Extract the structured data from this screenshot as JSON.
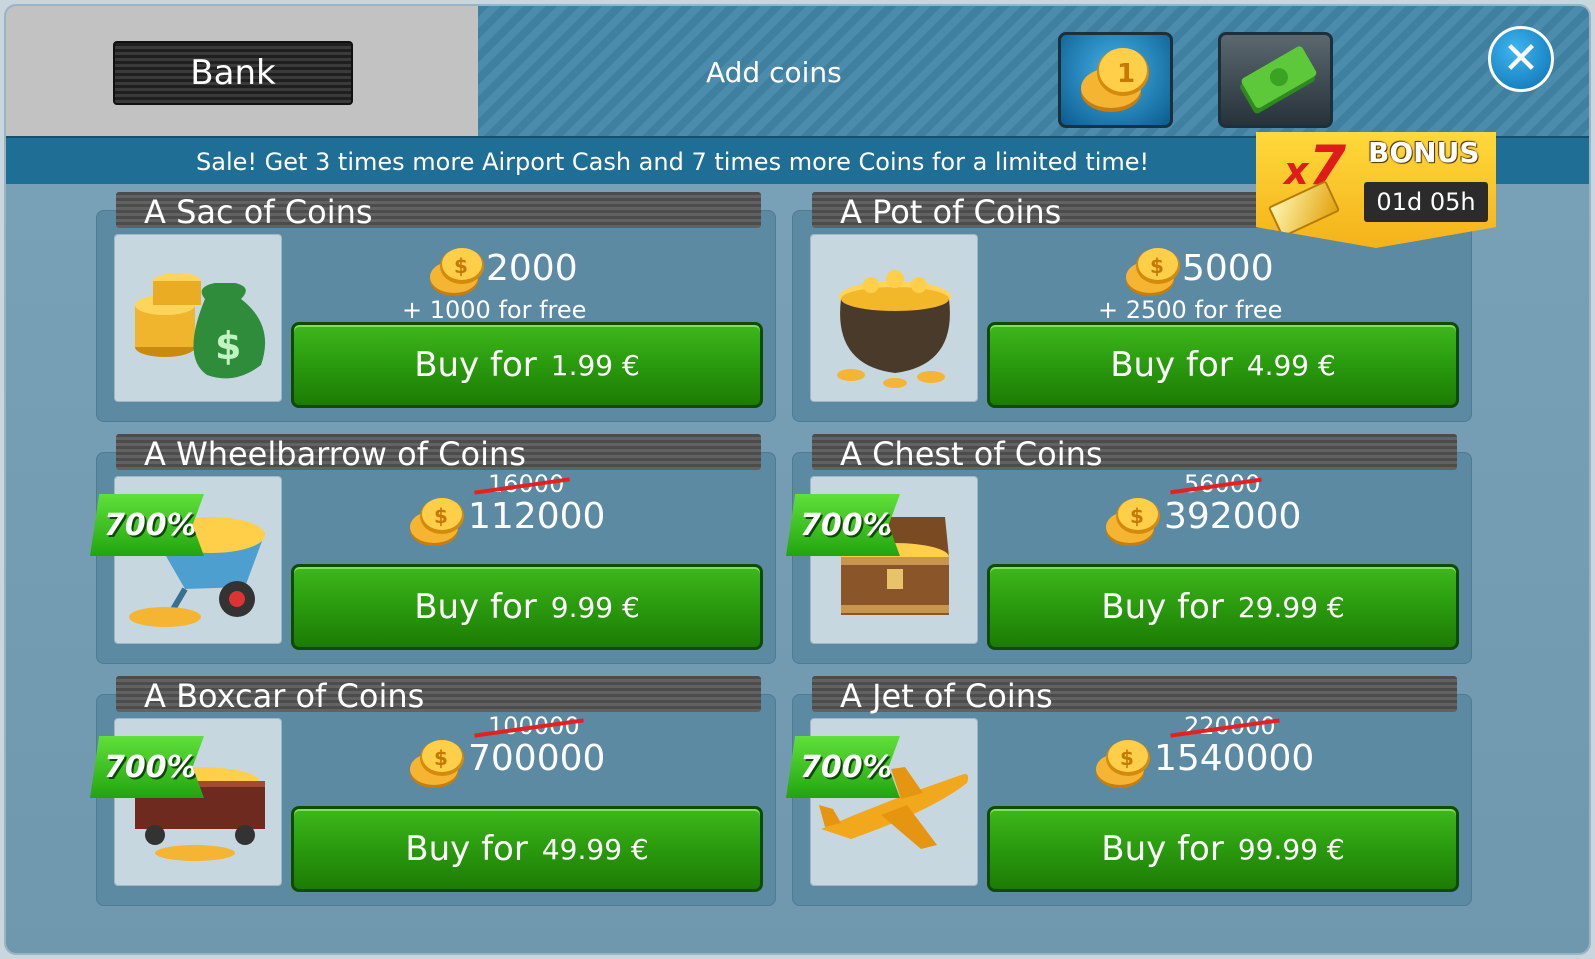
{
  "header": {
    "bank_label": "Bank",
    "add_coins_label": "Add coins",
    "close_label": "✕"
  },
  "sale_banner": {
    "text": "Sale! Get 3 times more Airport Cash and 7 times more Coins for a limited time!"
  },
  "bonus_badge": {
    "multiplier_prefix": "x",
    "multiplier_value": "7",
    "label": "BONUS",
    "timer": "01d 05h"
  },
  "packs": [
    {
      "title": "A Sac of Coins",
      "amount": "2000",
      "bonus_text": "+ 1000 for free",
      "buy_label": "Buy for",
      "price": "1.99 €",
      "image_icon": "money-bag-icon"
    },
    {
      "title": "A Pot of Coins",
      "amount": "5000",
      "bonus_text": "+ 2500 for free",
      "buy_label": "Buy for",
      "price": "4.99 €",
      "image_icon": "coin-pot-icon"
    },
    {
      "title": "A Wheelbarrow of Coins",
      "old_amount": "16000",
      "amount": "112000",
      "percent": "700%",
      "buy_label": "Buy for",
      "price": "9.99 €",
      "image_icon": "wheelbarrow-icon"
    },
    {
      "title": "A Chest of Coins",
      "old_amount": "56000",
      "amount": "392000",
      "percent": "700%",
      "buy_label": "Buy for",
      "price": "29.99 €",
      "image_icon": "treasure-chest-icon"
    },
    {
      "title": "A Boxcar of Coins",
      "old_amount": "100000",
      "amount": "700000",
      "percent": "700%",
      "buy_label": "Buy for",
      "price": "49.99 €",
      "image_icon": "boxcar-icon"
    },
    {
      "title": "A Jet of Coins",
      "old_amount": "220000",
      "amount": "1540000",
      "percent": "700%",
      "buy_label": "Buy for",
      "price": "99.99 €",
      "image_icon": "jet-icon"
    }
  ],
  "colors": {
    "buy_green": "#2b9d0f",
    "banner_blue": "#1f6e96",
    "strike_red": "#e52020",
    "bonus_gold": "#ffd93a"
  }
}
